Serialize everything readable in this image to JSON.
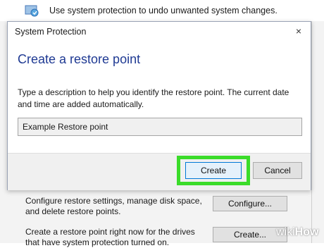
{
  "background": {
    "top_text": "Use system protection to undo unwanted system changes.",
    "configure_text": "Configure restore settings, manage disk space, and delete restore points.",
    "configure_button": "Configure...",
    "create_text": "Create a restore point right now for the drives that have system protection turned on.",
    "create_button": "Create..."
  },
  "dialog": {
    "title": "System Protection",
    "close_glyph": "×",
    "heading": "Create a restore point",
    "description": "Type a description to help you identify the restore point. The current date and time are added automatically.",
    "input_value": "Example Restore point",
    "create_label": "Create",
    "cancel_label": "Cancel"
  },
  "watermark": {
    "wiki": "wiki",
    "how": "How"
  },
  "colors": {
    "highlight": "#3bdc2a",
    "heading": "#1f3a93",
    "focus_border": "#0078d7"
  }
}
